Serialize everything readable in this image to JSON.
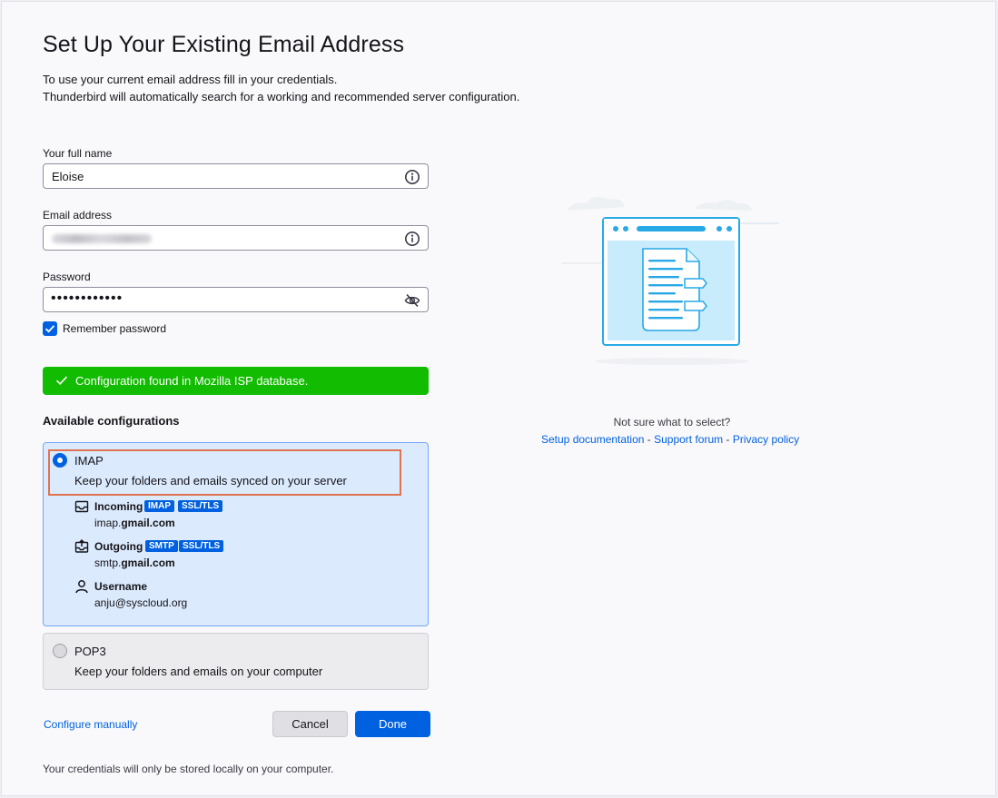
{
  "header": {
    "title": "Set Up Your Existing Email Address",
    "intro_line1": "To use your current email address fill in your credentials.",
    "intro_line2": "Thunderbird will automatically search for a working and recommended server configuration."
  },
  "form": {
    "name_label": "Your full name",
    "name_value": "Eloise",
    "email_label": "Email address",
    "password_label": "Password",
    "password_value": "••••••••••••",
    "remember_label": "Remember password",
    "remember_checked": true
  },
  "banner": {
    "text": "Configuration found in Mozilla ISP database.",
    "color": "#12bc00"
  },
  "configs": {
    "heading": "Available configurations",
    "imap": {
      "title": "IMAP",
      "desc": "Keep your folders and emails synced on your server",
      "selected": true,
      "incoming": {
        "label": "Incoming",
        "tag1": "IMAP",
        "tag2": "SSL/TLS",
        "host_prefix": "imap.",
        "host_domain": "gmail.com"
      },
      "outgoing": {
        "label": "Outgoing",
        "tag1": "SMTP",
        "tag2": "SSL/TLS",
        "host_prefix": "smtp.",
        "host_domain": "gmail.com"
      },
      "username": {
        "label": "Username",
        "value": "anju@syscloud.org"
      }
    },
    "pop3": {
      "title": "POP3",
      "desc": "Keep your folders and emails on your computer",
      "selected": false
    }
  },
  "actions": {
    "configure_manually": "Configure manually",
    "cancel": "Cancel",
    "done": "Done"
  },
  "footer": {
    "note": "Your credentials will only be stored locally on your computer."
  },
  "help": {
    "question": "Not sure what to select?",
    "setup_doc": "Setup documentation",
    "support_forum": "Support forum",
    "privacy_policy": "Privacy policy",
    "separator": " - "
  },
  "colors": {
    "accent": "#0061e0",
    "card_selected_bg": "#dbeafc",
    "highlight_border": "#e0734f"
  }
}
